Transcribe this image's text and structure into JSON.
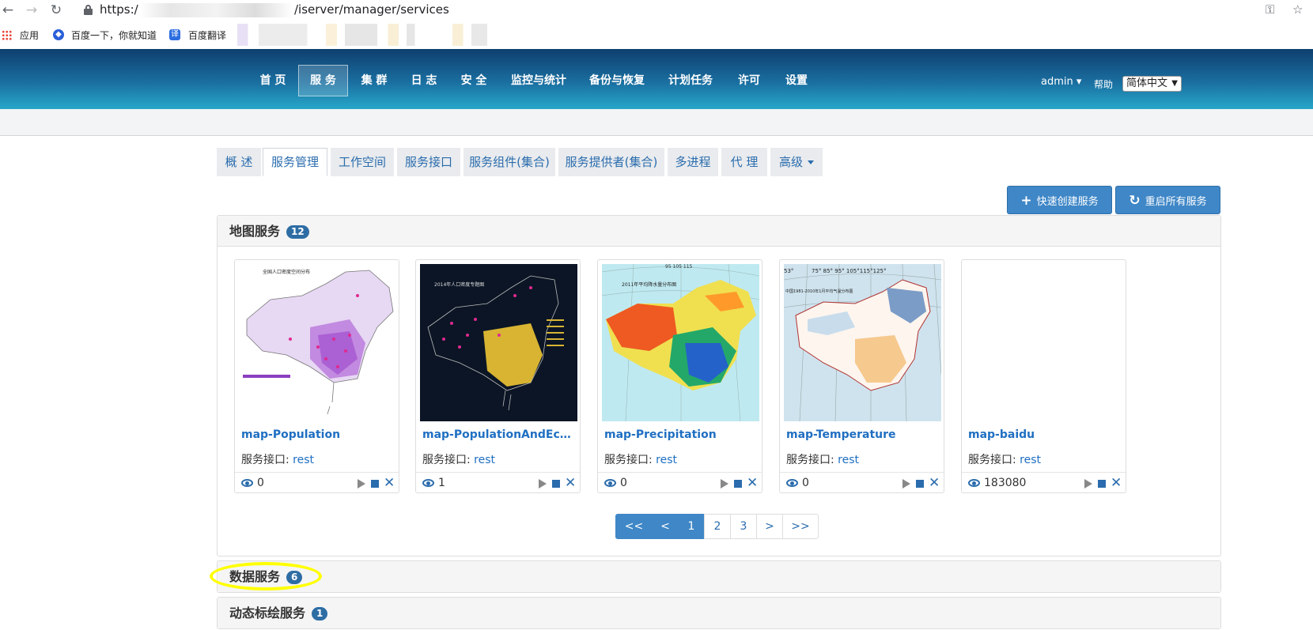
{
  "browser": {
    "url_prefix": "https:/",
    "url_path": "/iserver/manager/services",
    "bookmarks": [
      {
        "label": "应用"
      },
      {
        "label": "百度一下，你就知道"
      },
      {
        "label": "百度翻译"
      }
    ]
  },
  "topnav": {
    "items": [
      "首 页",
      "服 务",
      "集 群",
      "日 志",
      "安 全",
      "监控与统计",
      "备份与恢复",
      "计划任务",
      "许可",
      "设置"
    ],
    "active_index": 1,
    "user": "admin",
    "user_caret": "▾",
    "help": "帮助",
    "language": "简体中文"
  },
  "tabs": {
    "items": [
      "概 述",
      "服务管理",
      "工作空间",
      "服务接口",
      "服务组件(集合)",
      "服务提供者(集合)",
      "多进程",
      "代 理",
      "高级"
    ],
    "active_index": 1
  },
  "actions": {
    "quick_create": "快速创建服务",
    "restart_all": "重启所有服务"
  },
  "map_services": {
    "title": "地图服务",
    "count": "12",
    "iface_label": "服务接口: ",
    "cards": [
      {
        "name": "map-Population",
        "interface": "rest",
        "views": "0"
      },
      {
        "name": "map-PopulationAndEcono...",
        "interface": "rest",
        "views": "1"
      },
      {
        "name": "map-Precipitation",
        "interface": "rest",
        "views": "0"
      },
      {
        "name": "map-Temperature",
        "interface": "rest",
        "views": "0"
      },
      {
        "name": "map-baidu",
        "interface": "rest",
        "views": "183080"
      }
    ],
    "thumb_texts": {
      "population_title": "全国人口密度空间分布",
      "density_title": "2014年人口密度专题图",
      "precip_title": "2011年平均降水量分布图",
      "temp_title": "中国1981-2010年1月平均气温分布图",
      "temp_lons": "75° 85° 95° 105°115°125°",
      "temp_lat": "53°",
      "precip_lons": "95   105   115"
    },
    "pagination": [
      "<<",
      "<",
      "1",
      "2",
      "3",
      ">",
      ">>"
    ],
    "current_page": "1"
  },
  "data_services": {
    "title": "数据服务",
    "count": "6"
  },
  "dynamic_plot_services": {
    "title": "动态标绘服务",
    "count": "1"
  },
  "colors": {
    "accent": "#3f87c7",
    "nav_dark": "#0e3f6e",
    "nav_light": "#27a7c9",
    "link": "#1f6fc2",
    "highlight": "#ffff00"
  }
}
